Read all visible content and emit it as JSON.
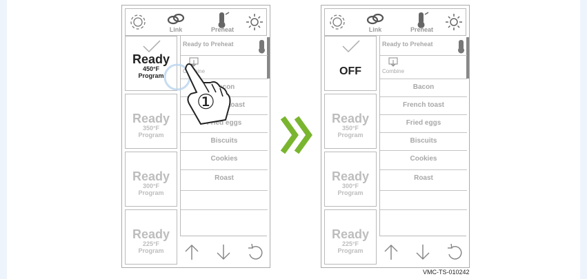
{
  "colors": {
    "accent_arrow": "#7ab52f",
    "muted_text": "#a8a8a8",
    "active_text": "#222222",
    "highlight_ring": "#b8d3ee"
  },
  "left_device": {
    "toolbar": {
      "link_label": "Link",
      "preheat_label": "Preheat"
    },
    "list_title": "Ready to Preheat",
    "combine_label": "Combine",
    "items": [
      "Bacon",
      "French toast",
      "Fried eggs",
      "Biscuits",
      "Cookies",
      "Roast"
    ],
    "presets": [
      {
        "state": "Ready",
        "temp": "450°F",
        "program": "Program"
      },
      {
        "state": "Ready",
        "temp": "350°F",
        "program": "Program"
      },
      {
        "state": "Ready",
        "temp": "300°F",
        "program": "Program"
      },
      {
        "state": "Ready",
        "temp": "225°F",
        "program": "Program"
      }
    ],
    "step_marker": "①"
  },
  "right_device": {
    "toolbar": {
      "link_label": "Link",
      "preheat_label": "Preheat"
    },
    "list_title": "Ready to Preheat",
    "combine_label": "Combine",
    "items": [
      "Bacon",
      "French toast",
      "Fried eggs",
      "Biscuits",
      "Cookies",
      "Roast"
    ],
    "first_preset_state": "OFF",
    "presets": [
      {
        "state": "Ready",
        "temp": "350°F",
        "program": "Program"
      },
      {
        "state": "Ready",
        "temp": "300°F",
        "program": "Program"
      },
      {
        "state": "Ready",
        "temp": "225°F",
        "program": "Program"
      }
    ]
  },
  "icons": [
    "gear-icon",
    "link-icon",
    "preheat-icon",
    "brightness-icon",
    "check-icon",
    "combine-icon",
    "arrow-up-icon",
    "arrow-down-icon",
    "undo-icon",
    "double-chevron-right-icon",
    "pointing-hand-icon"
  ],
  "caption": "VMC-TS-010242"
}
